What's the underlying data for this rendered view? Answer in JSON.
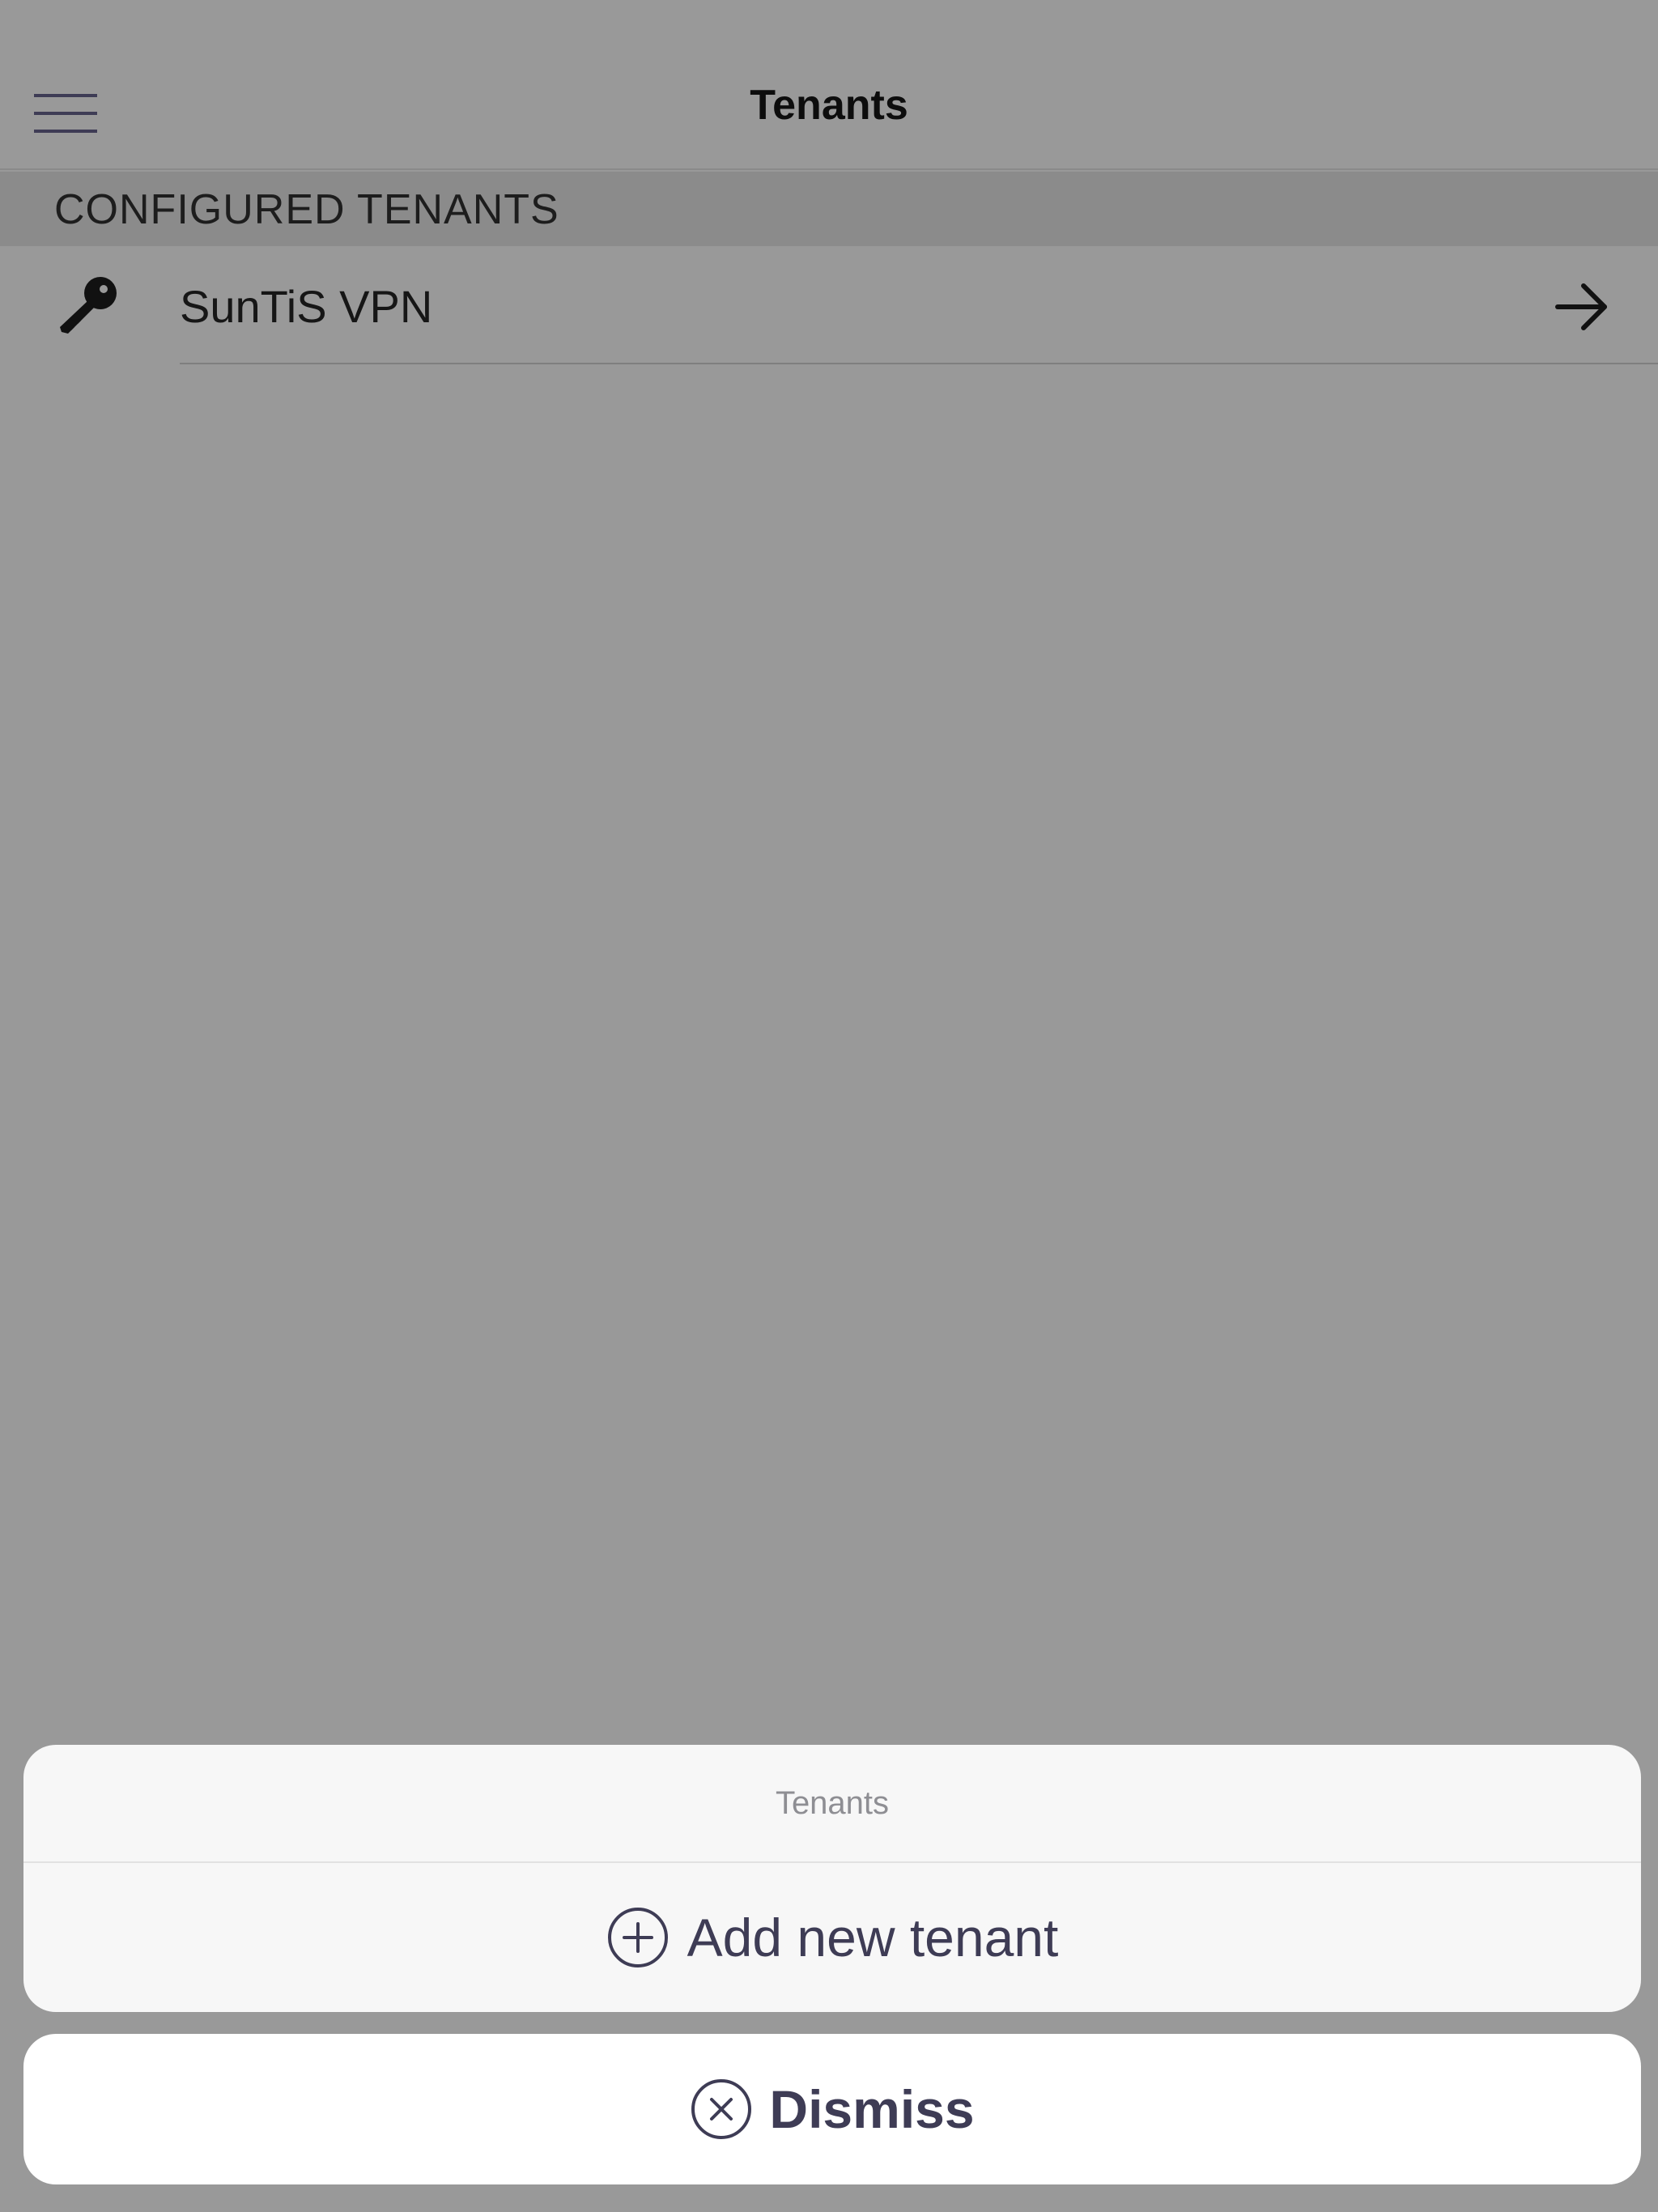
{
  "navbar": {
    "title": "Tenants",
    "menu_icon": "hamburger-menu-icon"
  },
  "section": {
    "header": "CONFIGURED TENANTS"
  },
  "tenants": [
    {
      "name": "SunTiS VPN",
      "icon": "key-icon",
      "accessory_icon": "arrow-right-icon"
    }
  ],
  "action_sheet": {
    "title": "Tenants",
    "actions": [
      {
        "label": "Add new tenant",
        "icon": "add-circle-icon"
      }
    ],
    "cancel": {
      "label": "Dismiss",
      "icon": "close-circle-icon"
    }
  },
  "colors": {
    "background_dim": "#999999",
    "section_header_bg": "#8b8b8b",
    "sheet_bg": "#f7f7f7",
    "dismiss_bg": "#ffffff",
    "action_text": "#3e3c55",
    "sheet_title_text": "#8e8e93"
  }
}
